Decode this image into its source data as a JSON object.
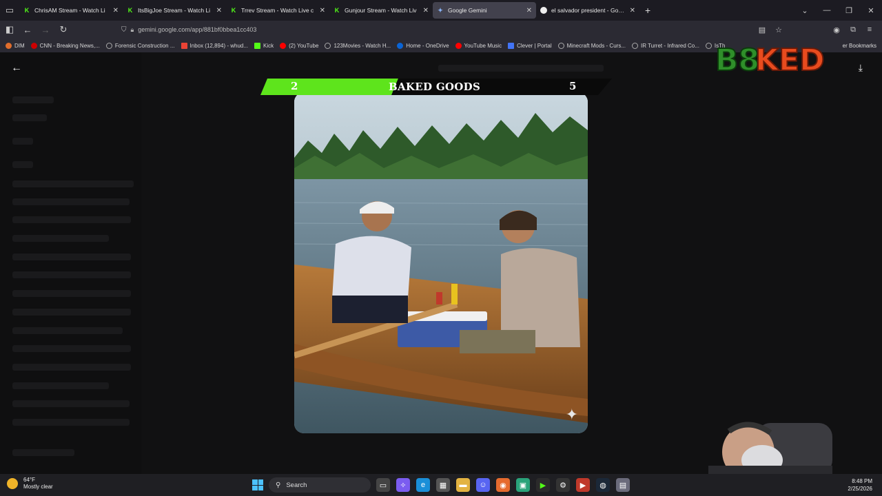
{
  "browser": {
    "tabs": [
      {
        "title": "ChrisAM Stream - Watch Li",
        "favicon": "kick-icon",
        "active": false
      },
      {
        "title": "ItsBigJoe Stream - Watch Li",
        "favicon": "kick-icon",
        "active": false
      },
      {
        "title": "Trrev Stream - Watch Live c",
        "favicon": "kick-icon",
        "active": false
      },
      {
        "title": "Gunjour Stream - Watch Liv",
        "favicon": "kick-icon",
        "active": false
      },
      {
        "title": "Google Gemini",
        "favicon": "gemini-icon",
        "active": true
      },
      {
        "title": "el salvador president - Google S",
        "favicon": "google-icon",
        "active": false
      }
    ],
    "url": "gemini.google.com/app/881bf0bbea1cc403",
    "bookmarks": [
      {
        "label": "DIM",
        "color": "#e06d2c"
      },
      {
        "label": "CNN - Breaking News,...",
        "color": "#cc0000"
      },
      {
        "label": "Forensic Construction ...",
        "color": "#aaaaaa"
      },
      {
        "label": "Inbox (12,894) - whud...",
        "color": "#ea4335"
      },
      {
        "label": "Kick",
        "color": "#53fc18"
      },
      {
        "label": "(2) YouTube",
        "color": "#ff0000"
      },
      {
        "label": "123Movies - Watch H...",
        "color": "#aaaaaa"
      },
      {
        "label": "Home - OneDrive",
        "color": "#0a64d6"
      },
      {
        "label": "YouTube Music",
        "color": "#ff0000"
      },
      {
        "label": "Clever | Portal",
        "color": "#4274f6"
      },
      {
        "label": "Minecraft Mods - Curs...",
        "color": "#aaaaaa"
      },
      {
        "label": "IR Turret - Infrared Co...",
        "color": "#aaaaaa"
      },
      {
        "label": "IsTh",
        "color": "#aaaaaa"
      }
    ],
    "other_bookmarks": "er Bookmarks"
  },
  "overlay": {
    "score_left": "2",
    "score_title": "BAKED GOODS",
    "score_right": "5",
    "logo_text": "B8KED"
  },
  "taskbar": {
    "weather_temp": "64°F",
    "weather_desc": "Mostly clear",
    "search_label": "Search",
    "time": "8:48 PM",
    "date": "2/25/2026"
  },
  "colors": {
    "accent_green": "#5ee41c",
    "kick_green": "#53fc18"
  }
}
